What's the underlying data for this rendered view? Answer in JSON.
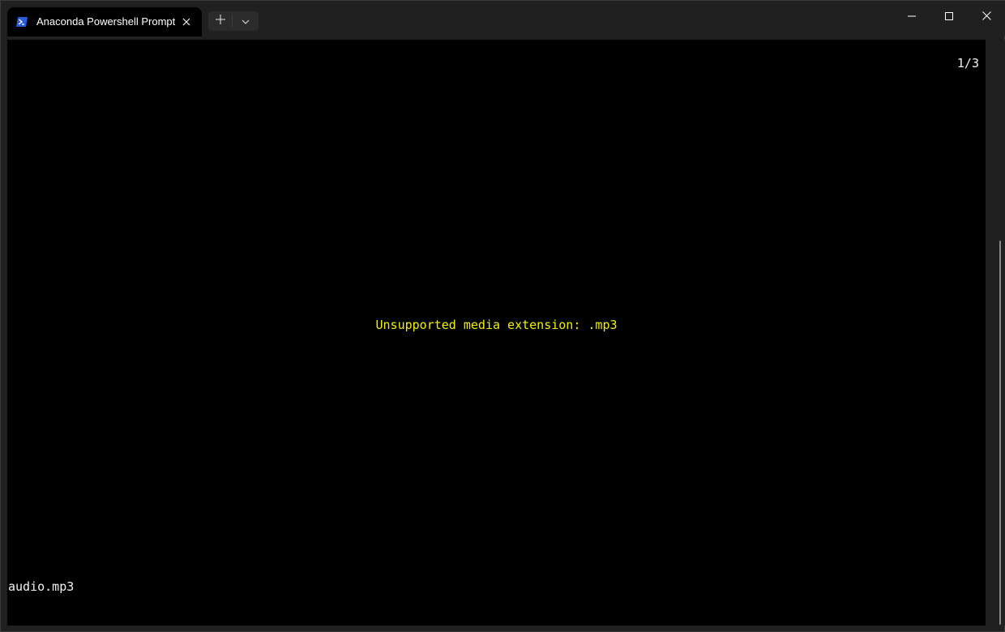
{
  "window": {
    "tab": {
      "title": "Anaconda Powershell Prompt",
      "icon": "powershell-icon"
    },
    "buttons": {
      "new_tab_icon": "plus-icon",
      "dropdown_icon": "chevron-down-icon",
      "minimize_icon": "minimize-icon",
      "maximize_icon": "maximize-icon",
      "close_icon": "close-icon"
    }
  },
  "terminal": {
    "page_counter": "1/3",
    "message": "Unsupported media extension: .mp3",
    "filename": "audio.mp3"
  },
  "colors": {
    "message": "#f0f000",
    "terminal_bg": "#000000",
    "chrome_bg": "#202020",
    "powershell_blue": "#2a5bd7"
  }
}
